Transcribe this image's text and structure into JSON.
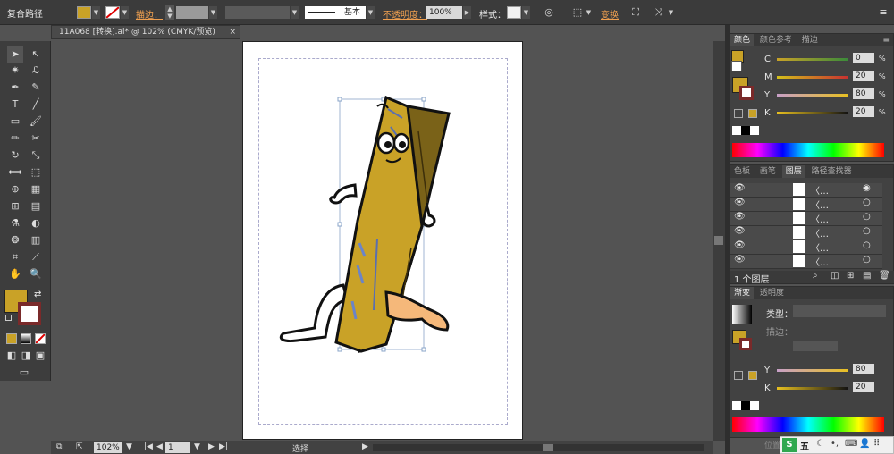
{
  "control_bar": {
    "selection_type": "复合路径",
    "stroke_label": "描边：",
    "stroke_profile": "基本",
    "opacity_label": "不透明度：",
    "opacity_value": "100%",
    "style_label": "样式：",
    "transform_label": "变换"
  },
  "document_tab": {
    "title": "11A068 [转换].ai* @ 102% (CMYK/预览)",
    "close": "×"
  },
  "colors": {
    "fill": "#c9a227",
    "accent_orange": "#f0a050"
  },
  "status_bar": {
    "zoom": "102%",
    "artboard": "1",
    "mode": "选择"
  },
  "color_panel": {
    "tabs": [
      "颜色",
      "颜色参考",
      "描边"
    ],
    "channels": [
      {
        "name": "C",
        "value": "0"
      },
      {
        "name": "M",
        "value": "20"
      },
      {
        "name": "Y",
        "value": "80"
      },
      {
        "name": "K",
        "value": "20"
      }
    ]
  },
  "layers_panel": {
    "tabs": [
      "色板",
      "画笔",
      "图层",
      "路径查找器"
    ],
    "rows": [
      "〈…",
      "〈…",
      "〈…",
      "〈…",
      "〈…",
      "〈…"
    ],
    "footer": "1 个图层"
  },
  "gradient_panel": {
    "tabs": [
      "渐变",
      "透明度"
    ],
    "type_label": "类型：",
    "stroke_label": "描边：",
    "channels": [
      {
        "name": "Y",
        "value": "80"
      },
      {
        "name": "K",
        "value": "20"
      }
    ]
  },
  "taskbar": {
    "ime": "五",
    "pos_label": "位置"
  }
}
